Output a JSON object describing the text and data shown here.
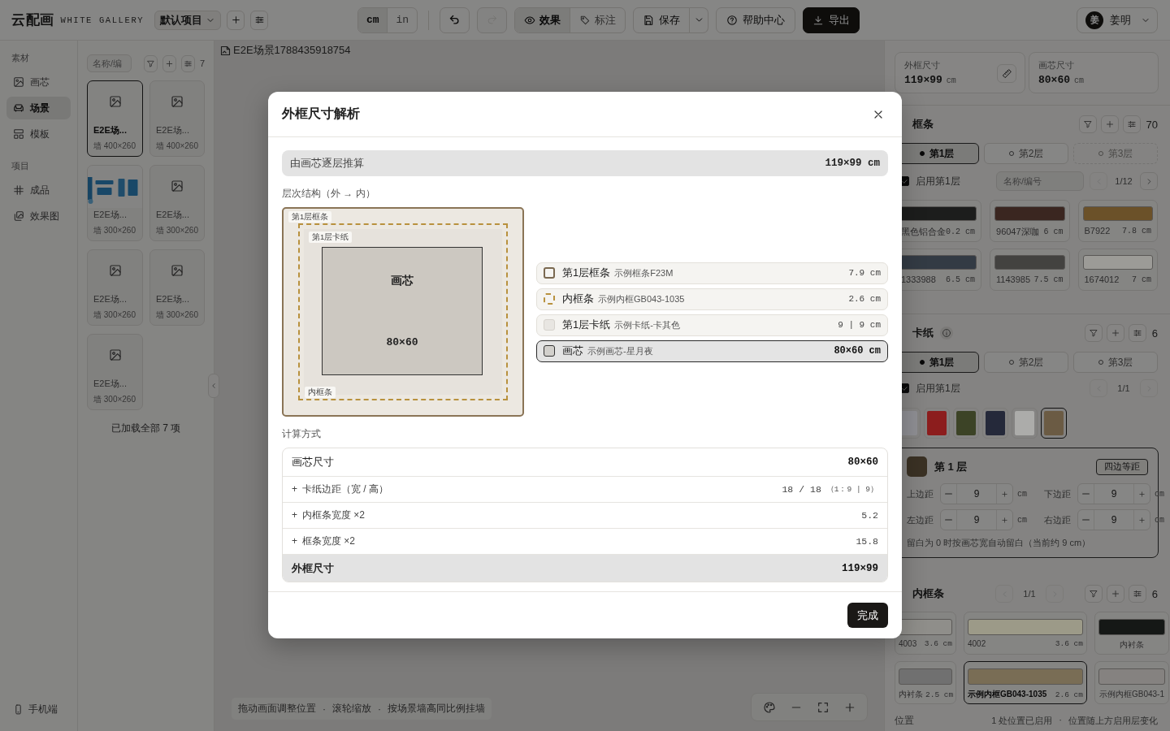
{
  "app": {
    "logo": "云配画",
    "subtitle": "WHITE GALLERY",
    "project": "默认项目"
  },
  "toolbar": {
    "units": [
      {
        "label": "cm",
        "selected": true
      },
      {
        "label": "in",
        "selected": false
      }
    ],
    "history": [
      {
        "kind": "undo",
        "disabled": false
      },
      {
        "kind": "redo",
        "disabled": true
      }
    ],
    "views": [
      {
        "label": "效果",
        "selected": true
      },
      {
        "label": "标注",
        "selected": false
      }
    ],
    "save": "保存",
    "help": "帮助中心",
    "export": "导出"
  },
  "user": {
    "initial": "姜",
    "name": "姜明"
  },
  "nav": {
    "sections": [
      {
        "title": "素材",
        "items": [
          {
            "label": "画芯",
            "selected": false
          },
          {
            "label": "场景",
            "selected": true
          },
          {
            "label": "模板",
            "selected": false
          }
        ]
      },
      {
        "title": "项目",
        "items": [
          {
            "label": "成品",
            "selected": false
          },
          {
            "label": "效果图",
            "selected": false
          }
        ]
      }
    ],
    "footer": "手机端"
  },
  "library": {
    "search_placeholder": "名称/编",
    "count": "7",
    "cards": [
      {
        "kind": "placeholder",
        "title": "E2E场...",
        "size": "墙 400×260",
        "selected": true
      },
      {
        "kind": "placeholder",
        "title": "E2E场...",
        "size": "墙 400×260",
        "selected": false
      },
      {
        "kind": "picture",
        "title": "E2E场...",
        "size": "墙 300×260",
        "selected": false
      },
      {
        "kind": "placeholder",
        "title": "E2E场...",
        "size": "墙 300×260",
        "selected": false
      },
      {
        "kind": "placeholder",
        "title": "E2E场...",
        "size": "墙 300×260",
        "selected": false
      },
      {
        "kind": "placeholder",
        "title": "E2E场...",
        "size": "墙 300×260",
        "selected": false
      },
      {
        "kind": "placeholder",
        "title": "E2E场...",
        "size": "墙 300×260",
        "selected": false
      }
    ],
    "footer": "已加载全部 7 项"
  },
  "canvas": {
    "image_alt": "E2E场景1788435918754",
    "separator": "·",
    "hints": [
      "拖动画面调整位置",
      "滚轮缩放",
      "按场景墙高同比例挂墙"
    ]
  },
  "summary": [
    {
      "label": "外框尺寸",
      "value": "119×99",
      "unit": "cm"
    },
    {
      "label": "画芯尺寸",
      "value": "80×60",
      "unit": "cm"
    }
  ],
  "frame_section": {
    "title": "框条",
    "count": "70",
    "layers": [
      {
        "label": "第1层",
        "selected": true,
        "disabled": false
      },
      {
        "label": "第2层",
        "selected": false,
        "disabled": false
      },
      {
        "label": "第3层",
        "selected": false,
        "disabled": true
      }
    ],
    "enable": {
      "label": "启用第1层",
      "checked": true
    },
    "search_placeholder": "名称/编号",
    "pager": {
      "label": "1/12",
      "prev_disabled": true,
      "next_disabled": false
    },
    "items": [
      {
        "name": "黑色铝合金",
        "width": "0.2 cm",
        "color": "#1c1d1c"
      },
      {
        "name": "96047深咖",
        "width": "6 cm",
        "color": "#3a2620"
      },
      {
        "name": "B7922",
        "width": "7.8 cm",
        "color": "#6b5129"
      },
      {
        "name": "1333988",
        "width": "6.5 cm",
        "color": "#333b44"
      },
      {
        "name": "1143985",
        "width": "7.5 cm",
        "color": "#434240"
      },
      {
        "name": "1674012",
        "width": "7 cm",
        "color": "#9c9b97"
      }
    ]
  },
  "mat_section": {
    "title": "卡纸",
    "count": "6",
    "layers": [
      {
        "label": "第1层",
        "selected": true,
        "disabled": false
      },
      {
        "label": "第2层",
        "selected": false,
        "disabled": false
      },
      {
        "label": "第3层",
        "selected": false,
        "disabled": false
      }
    ],
    "enable": {
      "label": "启用第1层",
      "checked": true
    },
    "pager": {
      "label": "1/1",
      "prev_disabled": true,
      "next_disabled": true
    },
    "colors": [
      {
        "color": "#8e8e93",
        "selected": false
      },
      {
        "color": "#8c1d1d",
        "selected": false
      },
      {
        "color": "#3c4326",
        "selected": false
      },
      {
        "color": "#25293a",
        "selected": false
      },
      {
        "color": "#acacaa",
        "selected": false
      },
      {
        "color": "#6b5b44",
        "selected": true
      }
    ],
    "layer_card": {
      "title": "第 1 层",
      "equal_button": "四边等距",
      "margins": [
        {
          "label": "上边距",
          "value": "9",
          "unit": "cm"
        },
        {
          "label": "下边距",
          "value": "9",
          "unit": "cm"
        },
        {
          "label": "左边距",
          "value": "9",
          "unit": "cm"
        },
        {
          "label": "右边距",
          "value": "9",
          "unit": "cm"
        }
      ],
      "note": "留白为 0 时按画芯宽自动留白（当前约 9 cm）"
    }
  },
  "liner_section": {
    "title": "内框条",
    "count": "6",
    "pager": {
      "label": "1/1",
      "prev_disabled": true,
      "next_disabled": true
    },
    "items": [
      {
        "name": "4003",
        "width": "3.6 cm",
        "color": "#8f8e8a",
        "selected": false
      },
      {
        "name": "4002",
        "width": "3.6 cm",
        "color": "#9c9a88",
        "selected": false
      },
      {
        "name": "内衬条",
        "color": "#151816",
        "selected": false
      },
      {
        "name": "内衬条",
        "width": "2.5 cm",
        "color": "#707070",
        "selected": false
      },
      {
        "name": "示例内框GB043-1035",
        "width": "2.6 cm",
        "color": "#796d55",
        "selected": true
      },
      {
        "name": "示例内框GB043-1",
        "color": "#858280",
        "selected": false
      }
    ]
  },
  "position": {
    "label": "位置",
    "separator": "·",
    "status": [
      "1 处位置已启用",
      "位置随上方启用层变化"
    ]
  },
  "dialog": {
    "title": "外框尺寸解析",
    "summary": {
      "label": "由画芯逐层推算",
      "value": "119×99 cm"
    },
    "structure_label": "层次结构（外 → 内）",
    "diagram": {
      "frame_label": "第1层框条",
      "mat_label": "第1层卡纸",
      "liner_label": "内框条",
      "core_label": "画芯",
      "core_size": "80×60"
    },
    "layers": [
      {
        "kind": "frame",
        "name": "第1层框条",
        "detail": "示例框条F23M",
        "value": "7.9 cm",
        "selected": false
      },
      {
        "kind": "liner",
        "name": "内框条",
        "detail": "示例内框GB043-1035",
        "value": "2.6 cm",
        "selected": false
      },
      {
        "kind": "mat",
        "name": "第1层卡纸",
        "detail": "示例卡纸-卡其色",
        "value": "9 | 9 cm",
        "selected": false
      },
      {
        "kind": "core",
        "name": "画芯",
        "detail": "示例画芯-星月夜",
        "value": "80×60 cm",
        "selected": true
      }
    ],
    "calc_label": "计算方式",
    "calc_rows": [
      {
        "kind": "base",
        "label": "画芯尺寸",
        "value": "80×60"
      },
      {
        "kind": "add",
        "sign": "+",
        "label": "卡纸边距（宽 / 高）",
        "value": "18 / 18",
        "note": "（1：9 | 9）"
      },
      {
        "kind": "add",
        "sign": "+",
        "label": "内框条宽度 ×2",
        "value": "5.2"
      },
      {
        "kind": "add",
        "sign": "+",
        "label": "框条宽度 ×2",
        "value": "15.8"
      },
      {
        "kind": "total",
        "label": "外框尺寸",
        "value": "119×99"
      }
    ],
    "done": "完成"
  }
}
